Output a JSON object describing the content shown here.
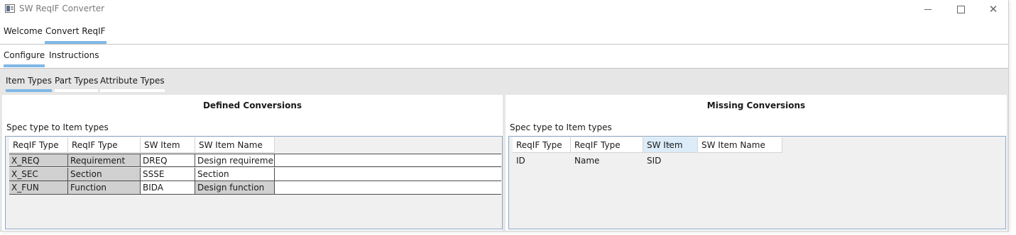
{
  "window": {
    "title": "SW ReqIF Converter"
  },
  "main_tabs": [
    {
      "label": "Welcome"
    },
    {
      "label": "Convert ReqIF"
    }
  ],
  "sub_tabs": [
    {
      "label": "Configure"
    },
    {
      "label": "Instructions"
    }
  ],
  "type_tabs": [
    {
      "label": "Item Types"
    },
    {
      "label": "Part Types"
    },
    {
      "label": "Attribute Types"
    }
  ],
  "defined": {
    "title": "Defined Conversions",
    "subheading": "Spec type to Item types",
    "columns": [
      "ReqIF Type ID",
      "ReqIF Type Name",
      "SW Item SID",
      "SW Item Name"
    ],
    "rows": [
      [
        "X_REQ",
        "Requirement",
        "DREQ",
        "Design requirement"
      ],
      [
        "X_SEC",
        "Section",
        "SSSE",
        "Section"
      ],
      [
        "X_FUN",
        "Function",
        "BIDA",
        "Design function"
      ]
    ]
  },
  "missing": {
    "title": "Missing Conversions",
    "subheading": "Spec type to Item types",
    "columns": [
      "ReqIF Type ID",
      "ReqIF Type Name",
      "SW Item SID",
      "SW Item Name"
    ],
    "sorted_column": "SW Item SID",
    "rows": []
  },
  "icons": {
    "app": "app-window-icon",
    "minimize": "minimize-icon",
    "maximize": "maximize-icon",
    "close": "close-icon",
    "sort": "sort-ascending-icon"
  },
  "colors": {
    "tab_underline": "#7fb8e6",
    "readonly_cell": "#d0d0d0",
    "content_bg": "#e6e6e6",
    "sorted_header": "#dcecf8"
  }
}
